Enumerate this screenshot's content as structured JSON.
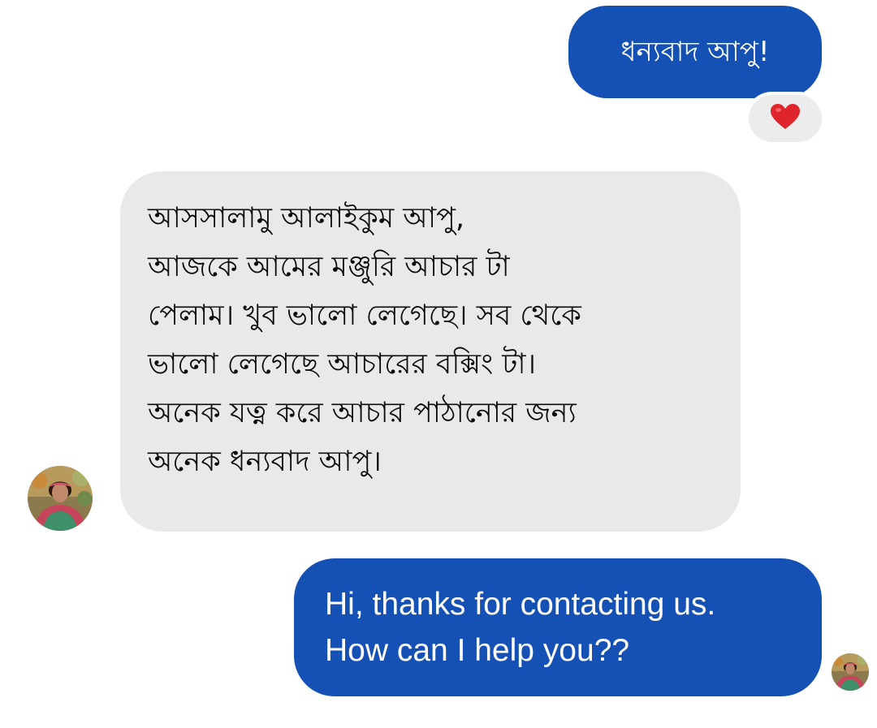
{
  "conversation": {
    "messages": [
      {
        "direction": "outgoing",
        "text": "ধন্যবাদ আপু!",
        "reaction": {
          "icon": "heart-icon",
          "emoji": "❤️",
          "color": "#e0242b"
        }
      },
      {
        "direction": "incoming",
        "lines": [
          "আসসালামু আলাইকুম আপু,",
          "আজকে আমের মঞ্জুরি আচার টা",
          "পেলাম। খুব ভালো লেগেছে।  সব থেকে",
          "ভালো লেগেছে আচারের বক্সিং টা।",
          "অনেক যত্ন করে আচার পাঠানোর জন্য",
          "অনেক ধন্যবাদ আপু।"
        ]
      },
      {
        "direction": "outgoing",
        "lines": [
          "Hi, thanks for contacting us.",
          "How can I help you??"
        ]
      }
    ],
    "colors": {
      "outgoing_bubble": "#1551b5",
      "incoming_bubble": "#e9e9e9",
      "reaction_pill": "#ececec"
    },
    "avatars": {
      "sender": "contact-avatar",
      "read_receipt": "read-receipt-avatar"
    }
  }
}
